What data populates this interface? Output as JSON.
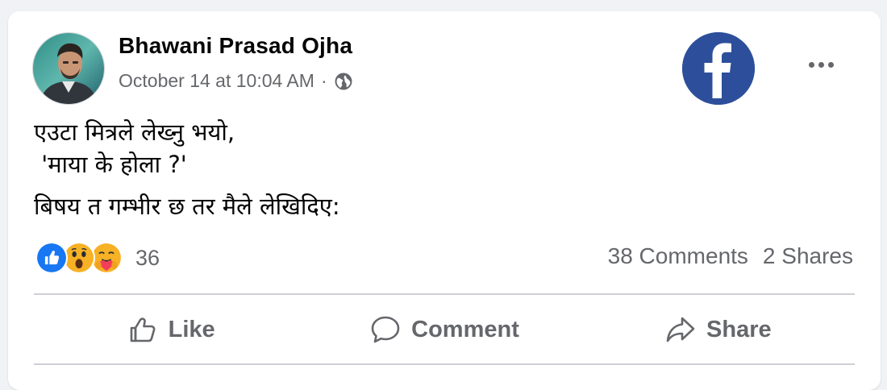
{
  "post": {
    "author": "Bhawani Prasad Ojha",
    "timestamp": "October 14 at 10:04 AM",
    "meta_separator": "·",
    "privacy_icon": "globe-icon",
    "text_lines": [
      "एउटा मित्रले लेख्नु भयो,",
      " 'माया के होला ?'",
      "बिषय त गम्भीर छ तर मैले लेखिदिए:"
    ]
  },
  "brand": {
    "logo": "facebook-logo",
    "color": "#2d4f9b"
  },
  "stats": {
    "reactions": [
      "like",
      "wow",
      "care"
    ],
    "reaction_count": "36",
    "comments": "38 Comments",
    "shares": "2 Shares"
  },
  "actions": {
    "like": "Like",
    "comment": "Comment",
    "share": "Share"
  },
  "colors": {
    "background": "#f0f2f5",
    "card": "#ffffff",
    "secondary_text": "#65676b",
    "like_blue": "#1877f2",
    "reaction_yellow": "#f7b125"
  }
}
